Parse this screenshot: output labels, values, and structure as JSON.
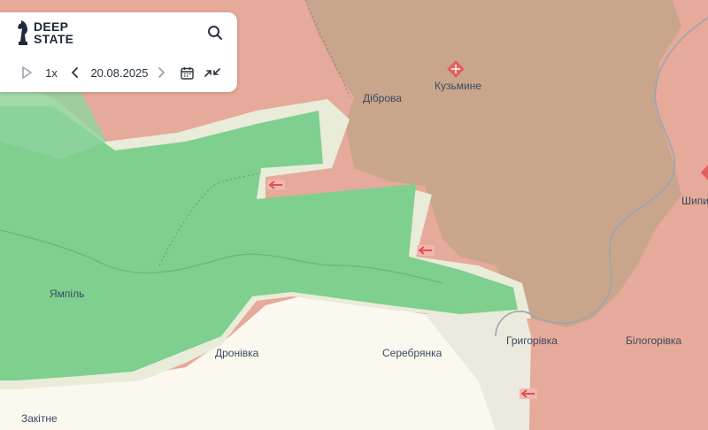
{
  "app": {
    "logo_line1": "DEEP",
    "logo_line2": "STATE"
  },
  "timeline": {
    "speed": "1x",
    "date": "20.08.2025"
  },
  "places": {
    "dibrova": "Діброва",
    "kuzmyne": "Кузьмине",
    "yampil": "Ямпіль",
    "dronivka": "Дронівка",
    "serebrianka": "Серебрянка",
    "hryhorivka": "Григорівка",
    "bilohorivka": "Білогорівка",
    "shypy": "Шипи",
    "zakitne": "Закітне"
  },
  "colors": {
    "occupied": "#e6aa9a",
    "occupied_dark": "#caa48c",
    "liberated": "#7fcf8f",
    "contested": "#eef0e2",
    "free": "#fbf8f0",
    "river": "#9aa6ac",
    "marker": "#d9534f"
  },
  "icons": [
    "logo-knight-icon",
    "search-icon",
    "play-icon",
    "chevron-left-icon",
    "chevron-right-icon",
    "calendar-icon",
    "compress-icon",
    "attack-arrow-icon",
    "captured-settlement-icon"
  ]
}
